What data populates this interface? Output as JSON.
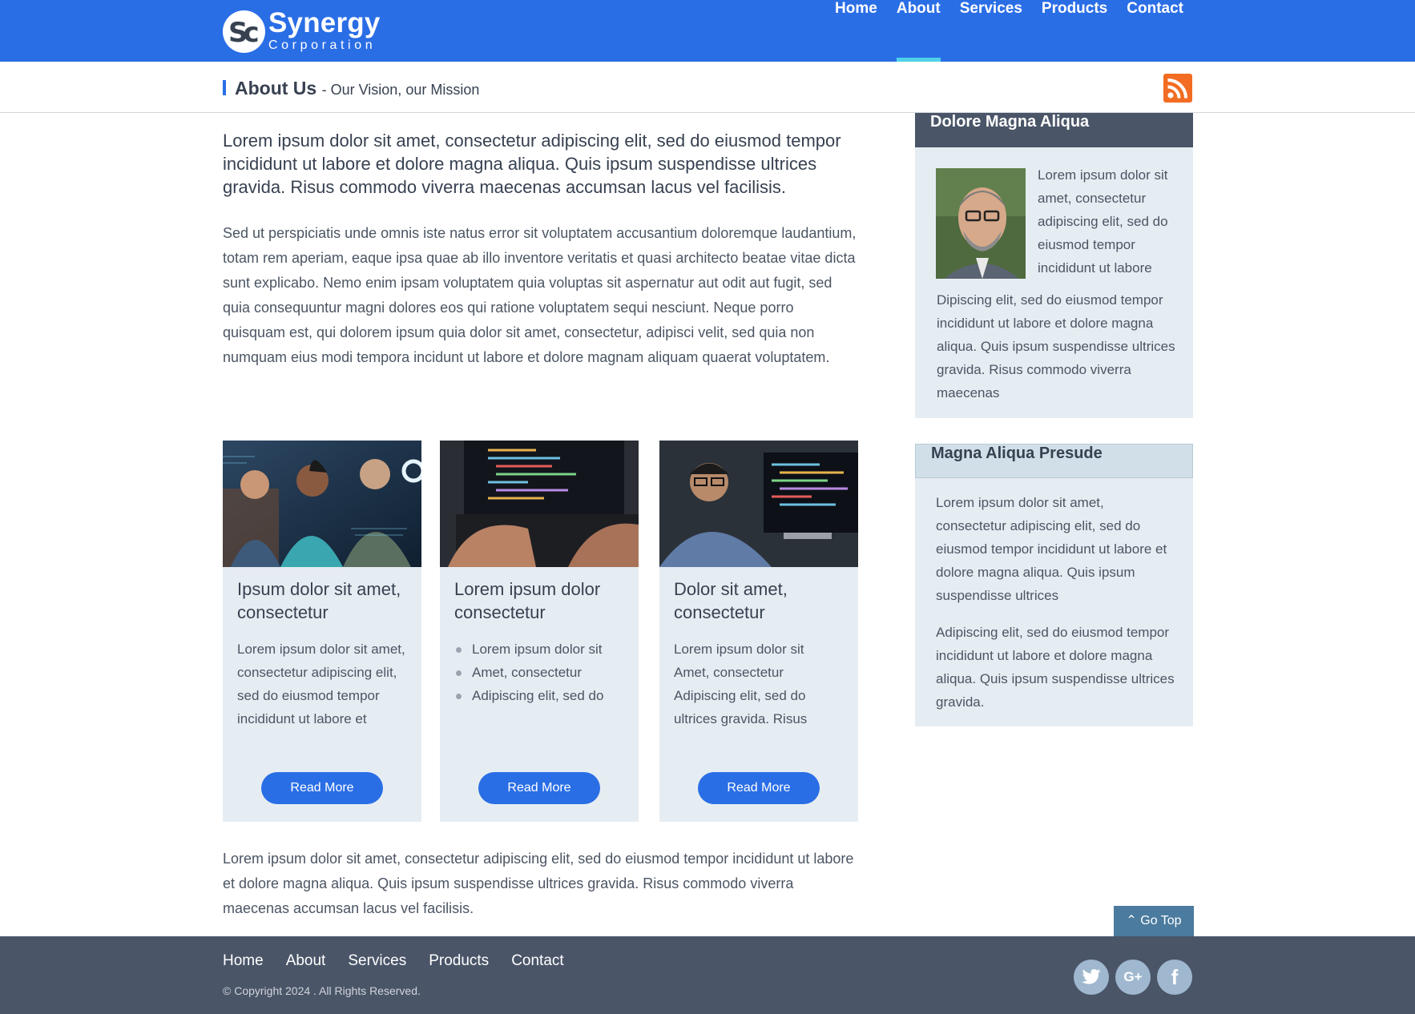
{
  "brand": {
    "logo_mark": "Sc",
    "name": "Synergy",
    "tagline": "Corporation"
  },
  "nav": {
    "items": [
      "Home",
      "About",
      "Services",
      "Products",
      "Contact"
    ],
    "active": "About"
  },
  "subheader": {
    "title": "About Us",
    "tagline": "- Our Vision, our Mission",
    "rss_icon": "rss-icon"
  },
  "main": {
    "lead": "Lorem ipsum dolor sit amet, consectetur adipiscing elit, sed do eiusmod tempor incididunt ut labore et dolore magna aliqua. Quis ipsum suspendisse ultrices gravida. Risus commodo viverra maecenas accumsan lacus vel facilisis.",
    "paragraph": "Sed ut perspiciatis unde omnis iste natus error sit voluptatem accusantium doloremque laudantium, totam rem aperiam, eaque ipsa quae ab illo inventore veritatis et quasi architecto beatae vitae dicta sunt explicabo. Nemo enim ipsam voluptatem quia voluptas sit aspernatur aut odit aut fugit, sed quia consequuntur magni dolores eos qui ratione voluptatem sequi nesciunt. Neque porro quisquam est, qui dolorem ipsum quia dolor sit amet, consectetur, adipisci velit, sed quia non numquam eius modi tempora incidunt ut labore et dolore magnam aliquam quaerat voluptatem.",
    "closing": "Lorem ipsum dolor sit amet, consectetur adipiscing elit, sed do eiusmod tempor incididunt ut labore et dolore magna aliqua. Quis ipsum suspendisse ultrices gravida. Risus commodo viverra maecenas accumsan lacus vel facilisis."
  },
  "cards": [
    {
      "title": "Ipsum dolor sit amet, consectetur",
      "body": "Lorem ipsum dolor sit amet, consectetur adipiscing elit, sed do eiusmod tempor incididunt ut labore et",
      "button": "Read More"
    },
    {
      "title": "Lorem ipsum dolor consectetur",
      "list": [
        "Lorem ipsum dolor sit",
        "Amet, consectetur",
        "Adipiscing elit, sed do"
      ],
      "button": "Read More"
    },
    {
      "title": "Dolor sit amet, consectetur",
      "body_lines": [
        "Lorem ipsum dolor sit",
        "Amet, consectetur",
        "Adipiscing elit, sed do",
        "ultrices gravida. Risus"
      ],
      "button": "Read More"
    }
  ],
  "sidebar": {
    "box1": {
      "title": "Dolore Magna Aliqua",
      "text1": "Lorem ipsum dolor sit amet, consectetur adipiscing elit, sed do eiusmod tempor incididunt ut labore",
      "text2": "Dipiscing elit, sed do eiusmod tempor incididunt ut labore et dolore magna aliqua. Quis ipsum suspendisse ultrices gravida. Risus commodo viverra maecenas"
    },
    "box2": {
      "title": "Magna Aliqua Presude",
      "text1": "Lorem ipsum dolor sit amet, consectetur adipiscing elit, sed do eiusmod tempor incididunt ut labore et dolore magna aliqua. Quis ipsum suspendisse ultrices",
      "text2": "Adipiscing elit, sed do eiusmod tempor incididunt ut labore et dolore magna aliqua. Quis ipsum suspendisse ultrices gravida."
    }
  },
  "gotop": {
    "label": "Go Top",
    "icon": "chevron-up-icon"
  },
  "footer": {
    "nav": [
      "Home",
      "About",
      "Services",
      "Products",
      "Contact"
    ],
    "copyright": "© Copyright 2024 . All Rights Reserved.",
    "social": [
      "twitter-icon",
      "google-plus-icon",
      "facebook-icon"
    ]
  },
  "colors": {
    "primary": "#2a6ee6",
    "dark": "#4a5568",
    "panel": "#e6edf2",
    "accent": "#4fd1e8",
    "rss": "#f26c22"
  }
}
